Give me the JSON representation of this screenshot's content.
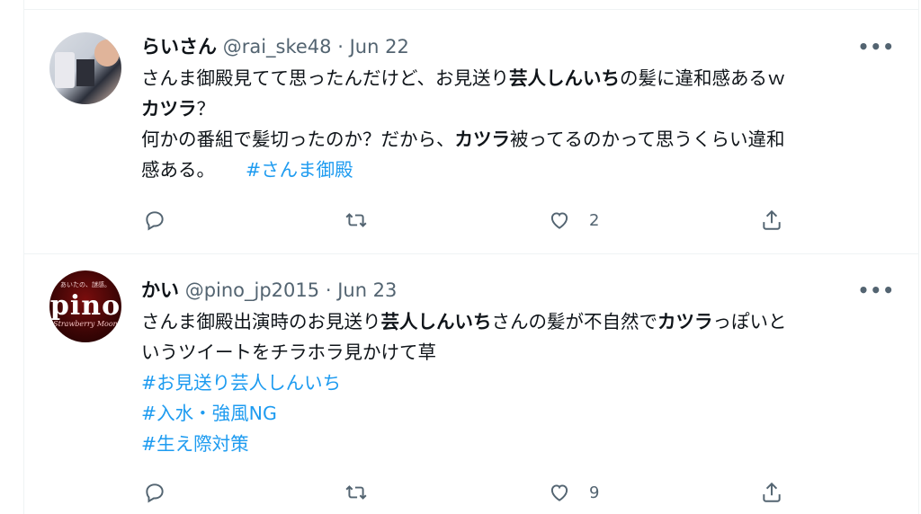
{
  "tweets": [
    {
      "name": "らいさん",
      "handle": "@rai_ske48",
      "sep": "·",
      "date": "Jun 22",
      "more_label": "•••",
      "text": {
        "l1a": "さんま御殿見てて思ったんだけど、お見送り",
        "l1b": "芸人しんいち",
        "l1c": "の髪に違和感あるｗ",
        "l2a": "カツラ",
        "l2b": "？",
        "l3a": "何かの番組で髪切ったのか？だから、",
        "l3b": "カツラ",
        "l3c": "被ってるのかって思うくらい違和",
        "l4a": "感ある。",
        "l4b": "#さんま御殿"
      },
      "reply_count": "",
      "retweet_count": "",
      "like_count": "2"
    },
    {
      "name": "かい",
      "handle": "@pino_jp2015",
      "sep": "·",
      "date": "Jun 23",
      "more_label": "•••",
      "avatar_text": {
        "top": "あいたの、謎感。",
        "main": "pino",
        "sub": "Strawberry Moon"
      },
      "text": {
        "l1a": "さんま御殿出演時のお見送り",
        "l1b": "芸人しんいち",
        "l1c": "さんの髪が不自然で",
        "l1d": "カツラ",
        "l1e": "っぽいと",
        "l2": "いうツイートをチラホラ見かけて草",
        "h1": "#お見送り芸人しんいち",
        "h2": "#入水・強風NG",
        "h3": "#生え際対策"
      },
      "reply_count": "",
      "retweet_count": "",
      "like_count": "9"
    }
  ],
  "icons": {
    "reply": "reply-icon",
    "retweet": "retweet-icon",
    "like": "heart-icon",
    "share": "share-icon",
    "more": "more-icon"
  },
  "colors": {
    "hashtag": "#1d9bf0",
    "secondary_text": "#536471",
    "divider": "#eff3f4"
  }
}
